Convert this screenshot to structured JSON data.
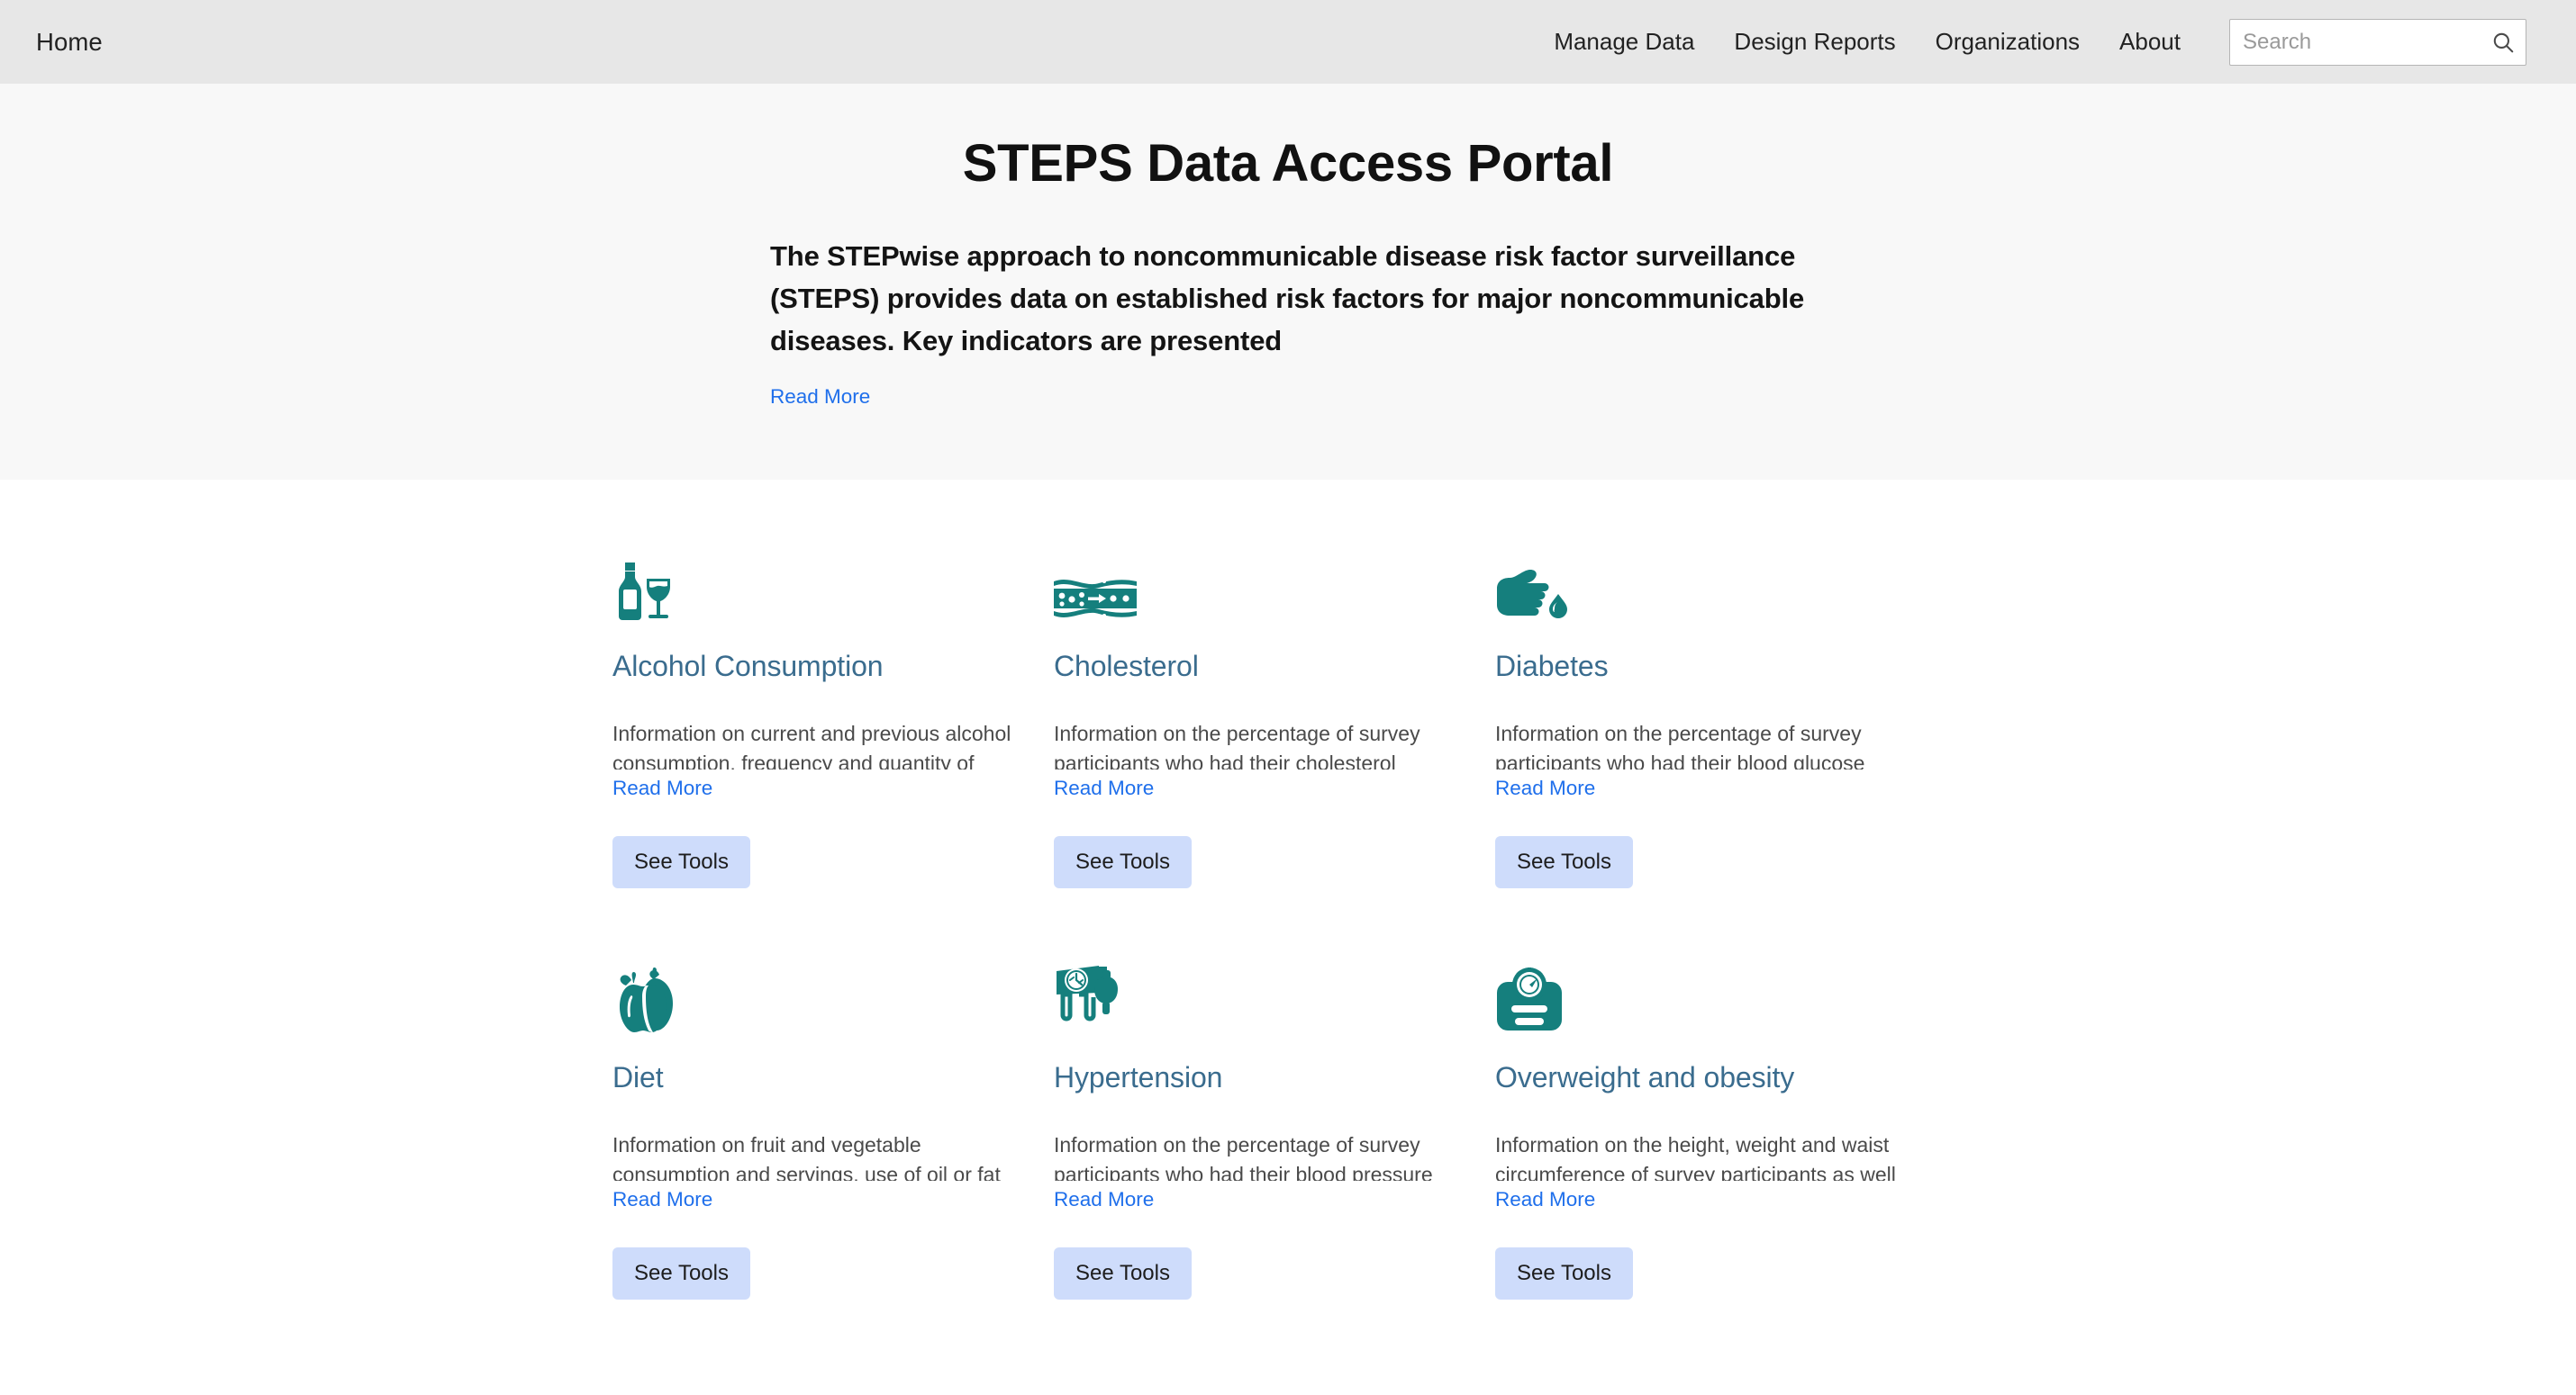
{
  "navbar": {
    "brand": "Home",
    "links": [
      {
        "label": "Manage Data"
      },
      {
        "label": "Design Reports"
      },
      {
        "label": "Organizations"
      },
      {
        "label": "About"
      }
    ],
    "search": {
      "placeholder": "Search",
      "value": "",
      "icon": "search-icon"
    }
  },
  "hero": {
    "title": "STEPS Data Access Portal",
    "subtitle": "The STEPwise approach to noncommunicable disease risk factor surveillance (STEPS) provides data on established risk factors for major noncommunicable diseases. Key indicators are presented",
    "read_more": "Read More"
  },
  "colors": {
    "header_bg": "#e7e7e7",
    "hero_bg": "#f8f8f8",
    "icon_teal": "#157f7d",
    "card_title_blue": "#3a6c8e",
    "link_blue": "#1f6feb",
    "button_bg": "#cedcfb"
  },
  "cards": [
    {
      "icon": "wine-bottle-and-glass-icon",
      "title": "Alcohol Consumption",
      "description": "Information on current and previous alcohol consumption, frequency and quantity of drinking, and heavy episodic drinking.",
      "read_more": "Read More",
      "button": "See Tools"
    },
    {
      "icon": "blood-vessel-cholesterol-icon",
      "title": "Cholesterol",
      "description": "Information on the percentage of survey participants who had their cholesterol measured and on cholesterol medication.",
      "read_more": "Read More",
      "button": "See Tools"
    },
    {
      "icon": "finger-blood-drop-icon",
      "title": "Diabetes",
      "description": "Information on the percentage of survey participants who had their blood glucose measured and on diabetes medication.",
      "read_more": "Read More",
      "button": "See Tools"
    },
    {
      "icon": "apple-and-pear-icon",
      "title": "Diet",
      "description": "Information on fruit and vegetable consumption and servings, use of oil or fat and amount of salt intake per day.",
      "read_more": "Read More",
      "button": "See Tools"
    },
    {
      "icon": "blood-pressure-monitor-icon",
      "title": "Hypertension",
      "description": "Information on the percentage of survey participants who had their blood pressure measured and on medication.",
      "read_more": "Read More",
      "button": "See Tools"
    },
    {
      "icon": "weighing-scale-icon",
      "title": "Overweight and obesity",
      "description": "Information on the height, weight and waist circumference of survey participants as well as body mass index statistics.",
      "read_more": "Read More",
      "button": "See Tools"
    }
  ]
}
